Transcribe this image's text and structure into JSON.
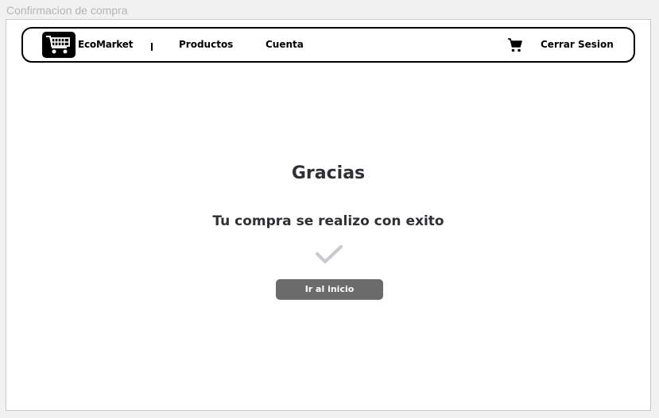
{
  "window": {
    "title": "Confirmacion de compra"
  },
  "navbar": {
    "brand": "EcoMarket",
    "divider": "|",
    "links": [
      {
        "label": "Productos"
      },
      {
        "label": "Cuenta"
      }
    ],
    "cart_icon": "shopping-cart-icon",
    "logout_label": "Cerrar Sesion",
    "logo_icon": "shopping-cart-logo-icon"
  },
  "main": {
    "title": "Gracias",
    "message": "Tu compra se realizo con exito",
    "status_icon": "check-icon",
    "button_label": "Ir al inicio"
  },
  "colors": {
    "button": "#6b6b6b",
    "check": "#c6c9ce",
    "text": "#2f3033",
    "border": "#000000"
  }
}
